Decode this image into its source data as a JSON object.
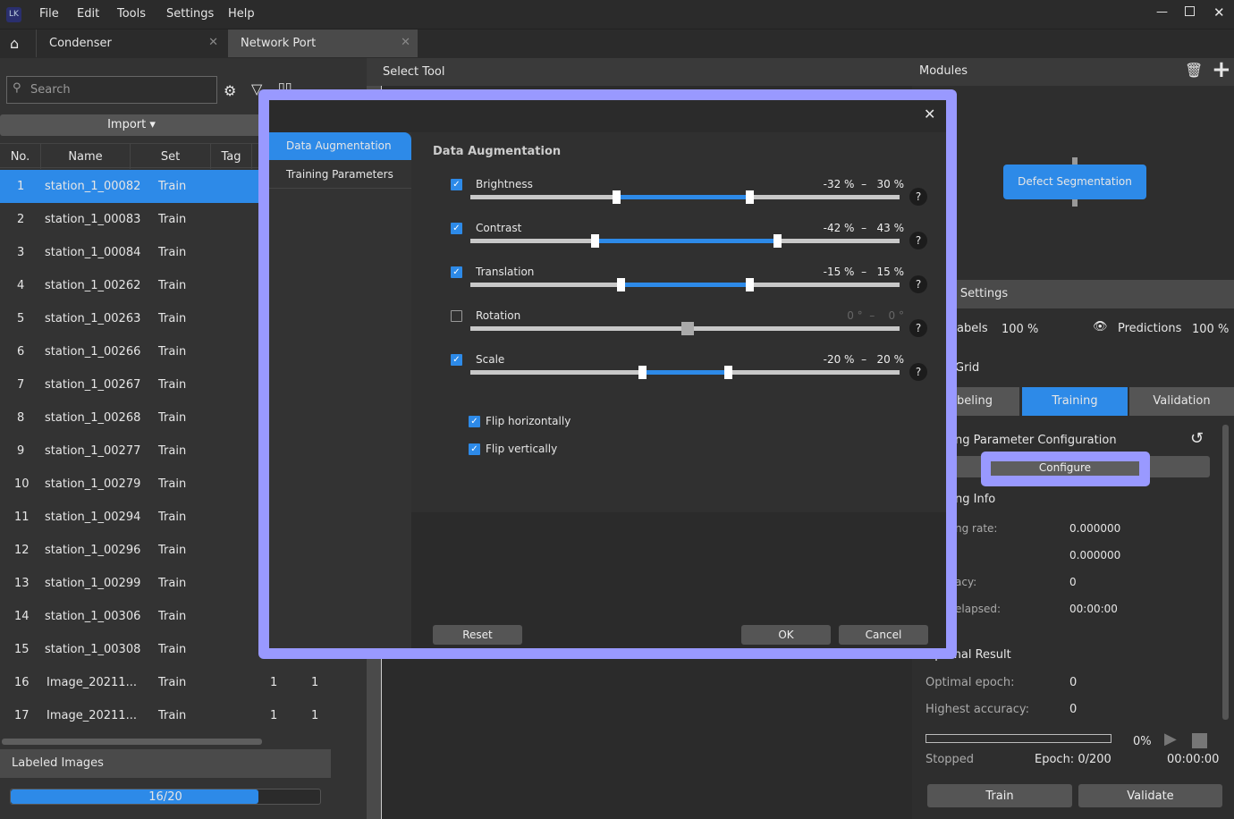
{
  "app": {
    "logo": "LK",
    "menu": [
      "File",
      "Edit",
      "Tools",
      "Settings",
      "Help"
    ]
  },
  "tabs": [
    {
      "label": "Condenser"
    },
    {
      "label": "Network Port"
    }
  ],
  "left": {
    "search_placeholder": "Search",
    "import_label": "Import ▾",
    "columns": [
      "No.",
      "Name",
      "Set",
      "Tag"
    ],
    "rows": [
      {
        "no": "1",
        "name": "station_1_00082",
        "set": "Train",
        "a": "",
        "b": ""
      },
      {
        "no": "2",
        "name": "station_1_00083",
        "set": "Train",
        "a": "",
        "b": ""
      },
      {
        "no": "3",
        "name": "station_1_00084",
        "set": "Train",
        "a": "",
        "b": ""
      },
      {
        "no": "4",
        "name": "station_1_00262",
        "set": "Train",
        "a": "",
        "b": ""
      },
      {
        "no": "5",
        "name": "station_1_00263",
        "set": "Train",
        "a": "",
        "b": ""
      },
      {
        "no": "6",
        "name": "station_1_00266",
        "set": "Train",
        "a": "",
        "b": ""
      },
      {
        "no": "7",
        "name": "station_1_00267",
        "set": "Train",
        "a": "",
        "b": ""
      },
      {
        "no": "8",
        "name": "station_1_00268",
        "set": "Train",
        "a": "",
        "b": ""
      },
      {
        "no": "9",
        "name": "station_1_00277",
        "set": "Train",
        "a": "",
        "b": ""
      },
      {
        "no": "10",
        "name": "station_1_00279",
        "set": "Train",
        "a": "",
        "b": ""
      },
      {
        "no": "11",
        "name": "station_1_00294",
        "set": "Train",
        "a": "",
        "b": ""
      },
      {
        "no": "12",
        "name": "station_1_00296",
        "set": "Train",
        "a": "",
        "b": ""
      },
      {
        "no": "13",
        "name": "station_1_00299",
        "set": "Train",
        "a": "",
        "b": ""
      },
      {
        "no": "14",
        "name": "station_1_00306",
        "set": "Train",
        "a": "",
        "b": ""
      },
      {
        "no": "15",
        "name": "station_1_00308",
        "set": "Train",
        "a": "",
        "b": ""
      },
      {
        "no": "16",
        "name": "Image_20211...",
        "set": "Train",
        "a": "1",
        "b": "1"
      },
      {
        "no": "17",
        "name": "Image_20211...",
        "set": "Train",
        "a": "1",
        "b": "1"
      }
    ],
    "selected_row": 0,
    "labeled_title": "Labeled Images",
    "labeled_text": "16/20",
    "labeled_fraction": 0.8
  },
  "mid": {
    "header": "Select Tool"
  },
  "right": {
    "modules_title": "Modules",
    "module_node": "Defect Segmentation",
    "settings_title": "y Settings",
    "labels": "abels",
    "labels_pct": "100  %",
    "predictions": "Predictions",
    "pred_pct": "100  %",
    "grid": "Grid",
    "mode_tabs": [
      "beling",
      "Training",
      "Validation"
    ],
    "param_title": "ng Parameter Configuration",
    "configure": "Configure",
    "info_title": "ng Info",
    "info": [
      {
        "k": "ng rate:",
        "v": "0.000000"
      },
      {
        "k": "",
        "v": "0.000000"
      },
      {
        "k": "acy:",
        "v": "0"
      },
      {
        "k": "elapsed:",
        "v": "00:00:00"
      }
    ],
    "optimal_title": "Optimal Result",
    "optimal": [
      {
        "k": "Optimal epoch:",
        "v": "0"
      },
      {
        "k": "Highest accuracy:",
        "v": "0"
      }
    ],
    "progress_pct": "0%",
    "progress": 0,
    "status": "Stopped",
    "epoch": "Epoch: 0/200",
    "time": "00:00:00",
    "train": "Train",
    "validate": "Validate"
  },
  "dialog": {
    "nav": [
      "Data Augmentation",
      "Training Parameters"
    ],
    "title": "Data Augmentation",
    "sliders": [
      {
        "label": "Brightness",
        "on": true,
        "lo": -32,
        "hi": 30,
        "min": -100,
        "max": 100,
        "text": "-32 %  –   30 %"
      },
      {
        "label": "Contrast",
        "on": true,
        "lo": -42,
        "hi": 43,
        "min": -100,
        "max": 100,
        "text": "-42 %  –   43 %"
      },
      {
        "label": "Translation",
        "on": true,
        "lo": -15,
        "hi": 15,
        "min": -50,
        "max": 50,
        "text": "-15 %  –   15 %"
      },
      {
        "label": "Rotation",
        "on": false,
        "lo": 0,
        "hi": 0,
        "min": -180,
        "max": 180,
        "text": "0 °  –    0 °"
      },
      {
        "label": "Scale",
        "on": true,
        "lo": -20,
        "hi": 20,
        "min": -100,
        "max": 100,
        "text": "-20 %  –   20 %"
      }
    ],
    "flip_h": "Flip horizontally",
    "flip_v": "Flip vertically",
    "reset": "Reset",
    "ok": "OK",
    "cancel": "Cancel"
  },
  "colors": {
    "accent": "#2d8ae8",
    "highlight": "#9999ff"
  }
}
